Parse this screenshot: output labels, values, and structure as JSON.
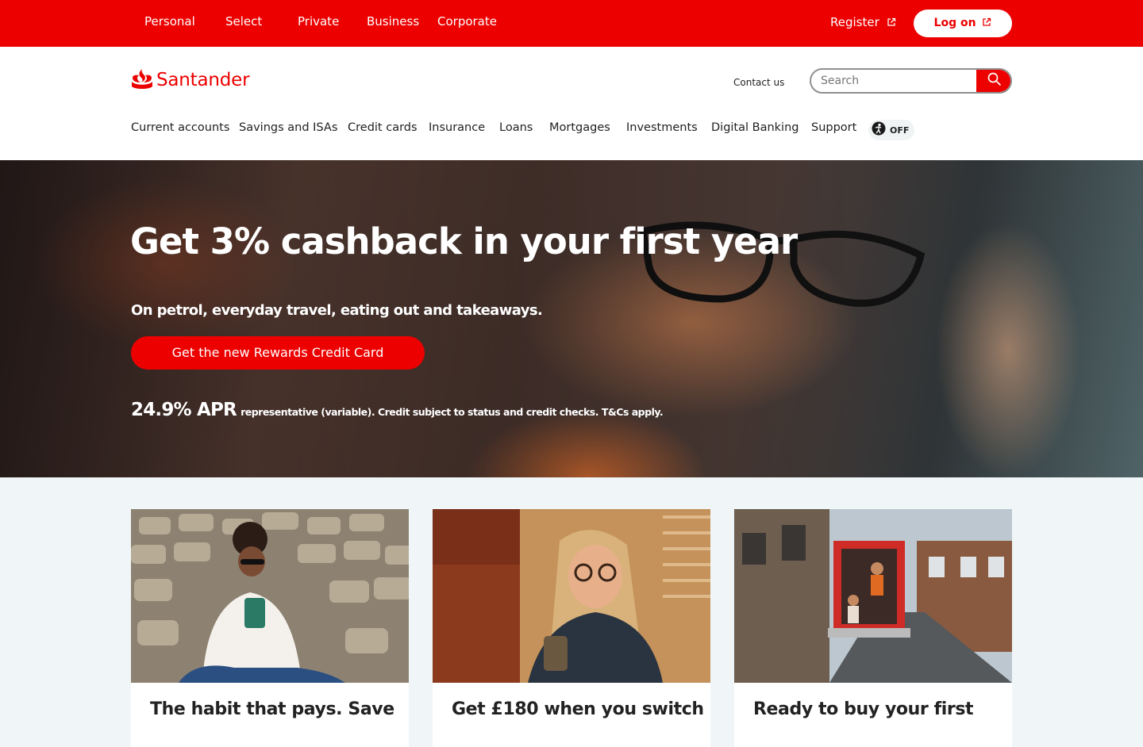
{
  "topbar": {
    "segments": [
      "Personal",
      "Select",
      "Private",
      "Business",
      "Corporate"
    ],
    "register_label": "Register",
    "logon_label": "Log on"
  },
  "header": {
    "logo_text": "Santander",
    "contact_label": "Contact us",
    "search_placeholder": "Search",
    "nav": [
      "Current accounts",
      "Savings and ISAs",
      "Credit cards",
      "Insurance",
      "Loans",
      "Mortgages",
      "Investments",
      "Digital Banking",
      "Support"
    ],
    "toggle_label": "OFF"
  },
  "hero": {
    "title": "Get 3% cashback in your first year",
    "subtitle": "On petrol, everyday travel, eating out and takeaways.",
    "cta_label": "Get the new Rewards Credit Card",
    "apr_rate": "24.9% APR",
    "apr_terms": "representative (variable). Credit subject to status and credit checks. T&Cs apply."
  },
  "cards": [
    {
      "title": "The habit that pays. Save"
    },
    {
      "title": "Get £180 when you switch"
    },
    {
      "title": "Ready to buy your first"
    }
  ],
  "colors": {
    "brand_red": "#ec0000",
    "page_bg": "#f0f6f8"
  },
  "icons": [
    "external-link-icon",
    "search-icon",
    "flame-logo-icon",
    "accessibility-toggle-icon"
  ]
}
